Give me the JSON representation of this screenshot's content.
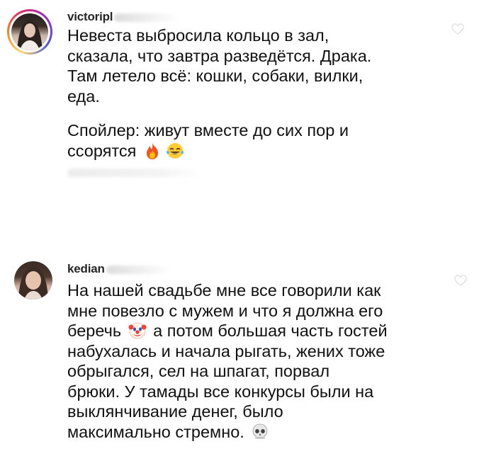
{
  "comments": [
    {
      "username": "victoripl",
      "text_1": "Невеста выбросила кольцо в зал,\nсказала, что завтра разведётся. Драка.\nТам летело всё: кошки, собаки, вилки,\nеда.",
      "text_2": "Спойлер: живут вместе до сих пор и\nссорятся",
      "emojis": [
        "fire-emoji",
        "tears-of-joy-emoji"
      ]
    },
    {
      "username": "kedian",
      "text_part1": "На нашей свадьбе мне все говорили как\nмне повезло с мужем и что я должна его\nберечь",
      "text_part2": " а потом большая часть гостей\nнабухалась и начала рыгать, жених тоже\nобрыгался, сел на шпагат, порвал\nбрюки. У тамады все конкурсы были на\nвыклянчивание денег, было\nмаксимально стремно.",
      "emojis": [
        "clown-emoji",
        "skull-emoji"
      ]
    }
  ],
  "colors": {
    "text": "#111111",
    "username": "#262626",
    "story_ring": [
      "#feda75",
      "#fa7e1e",
      "#d62976",
      "#962fbf",
      "#4f5bd5"
    ]
  },
  "icons": [
    "heart-icon"
  ]
}
